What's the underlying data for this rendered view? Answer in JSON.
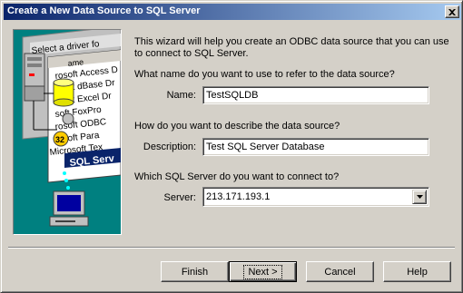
{
  "window": {
    "title": "Create a New Data Source to SQL Server"
  },
  "intro": "This wizard will help you create an ODBC data source that you can use to connect to SQL Server.",
  "name_question": "What name do you want to use to refer to the data source?",
  "name_label": "Name:",
  "name_value": "TestSQLDB",
  "description_question": "How do you want to describe the data source?",
  "description_label": "Description:",
  "description_value": "Test SQL Server Database",
  "server_question": "Which SQL Server do you want to connect to?",
  "server_label": "Server:",
  "server_value": "213.171.193.1",
  "buttons": {
    "finish": "Finish",
    "next": "Next >",
    "cancel": "Cancel",
    "help": "Help"
  },
  "graphic": {
    "header": "Select a driver fo",
    "col": "ame",
    "items": [
      "rosoft Access D",
      "osoft dBase Dr",
      "osoft Excel Dr",
      "soft FoxPro",
      "rosoft ODBC",
      "rosoft Para",
      "Microsoft Tex"
    ],
    "selected": "SQL Serv",
    "badge": "32"
  },
  "colors": {
    "title_start": "#0a246a",
    "title_end": "#a6caf0",
    "face": "#d4d0c8",
    "graphic_bg": "#008080"
  },
  "icons": [
    "close-icon",
    "dropdown-arrow-icon",
    "server-icon",
    "database-icon",
    "computer-icon"
  ]
}
